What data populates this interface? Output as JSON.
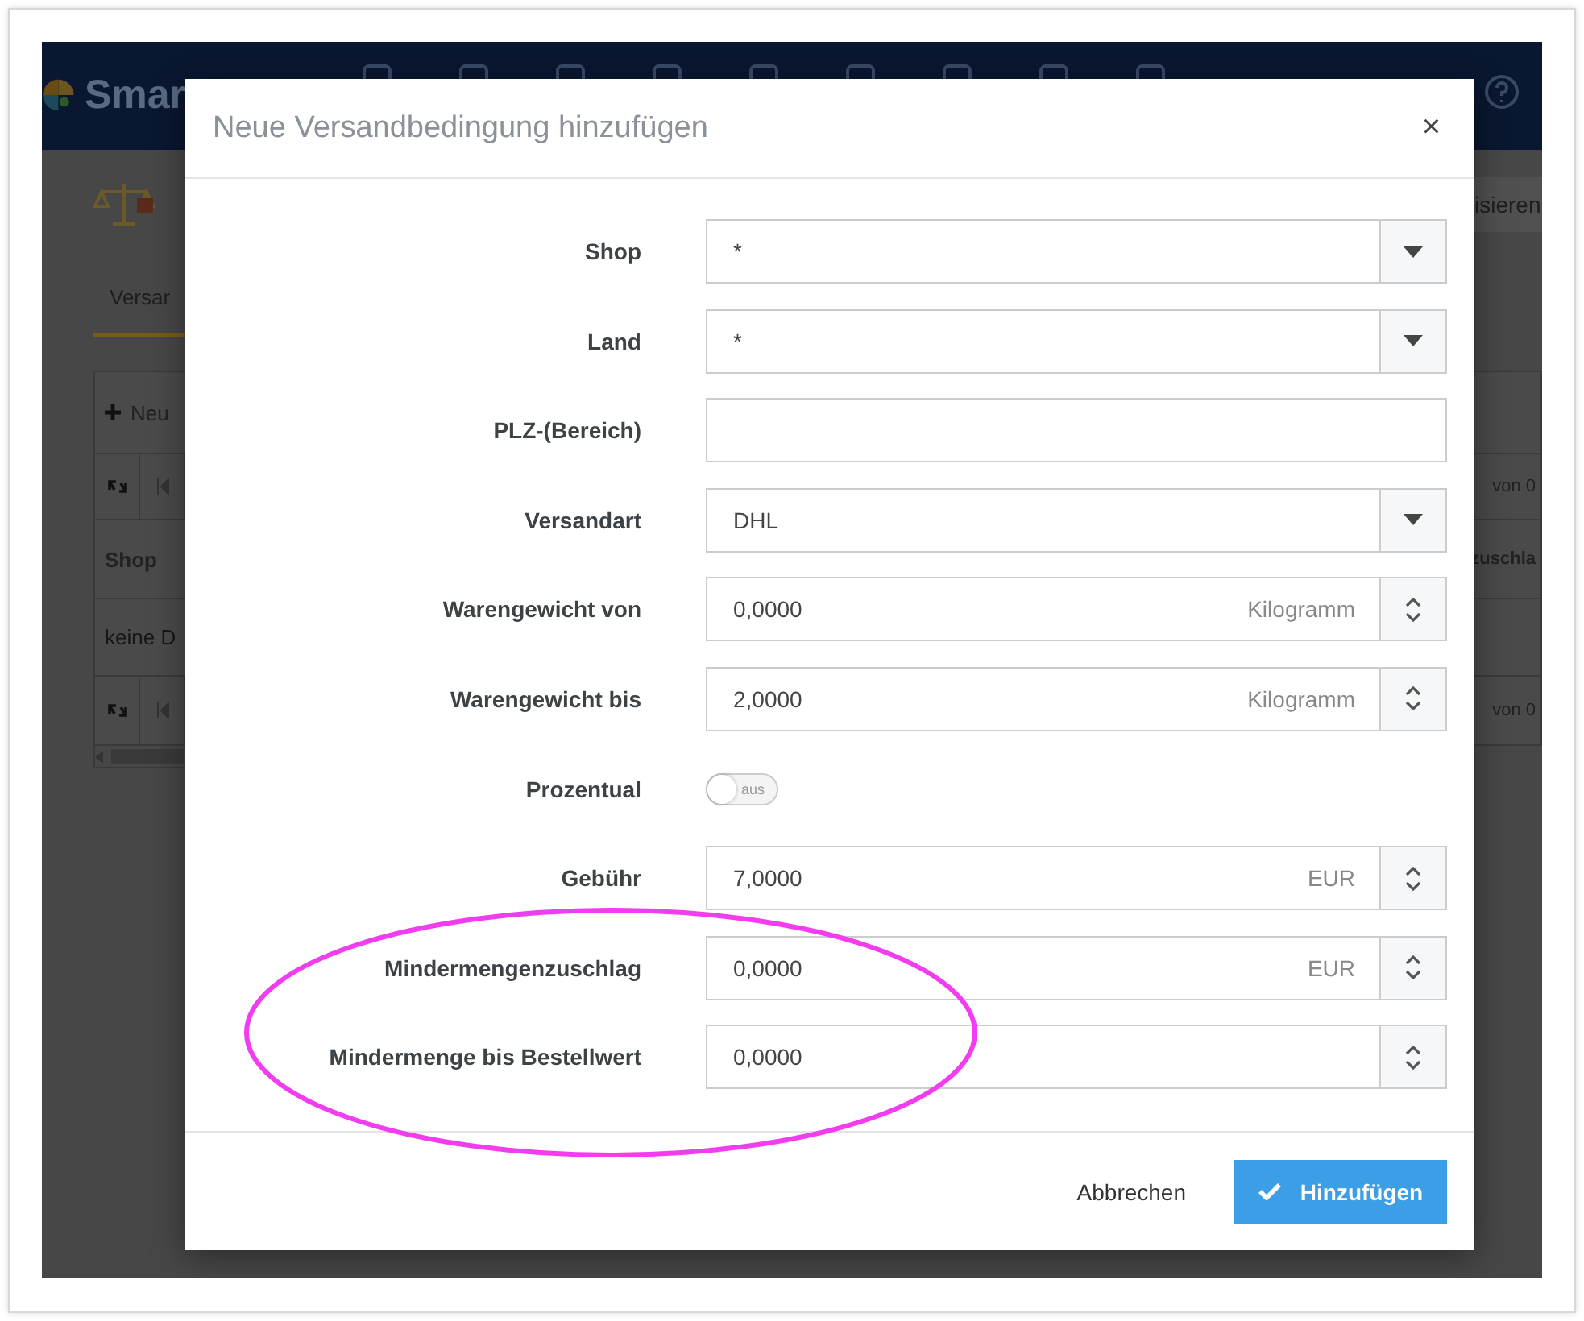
{
  "background": {
    "brand": "Smar",
    "header_button": "isieren",
    "tab": "Versar",
    "toolbar_button": "Neu",
    "pager_text": "von 0",
    "column_1": "Shop",
    "column_last": "zuschla",
    "empty_text": "keine D",
    "pager_text_bottom": "von 0"
  },
  "dialog": {
    "title": "Neue Versandbedingung hinzufügen",
    "close": "×",
    "fields": [
      {
        "kind": "select",
        "label": "Shop",
        "value": "*"
      },
      {
        "kind": "select",
        "label": "Land",
        "value": "*"
      },
      {
        "kind": "text",
        "label": "PLZ-(Bereich)"
      },
      {
        "kind": "select",
        "label": "Versandart",
        "value": "DHL"
      },
      {
        "kind": "number",
        "label": "Warengewicht von",
        "value": "0,0000",
        "unit": "Kilogramm"
      },
      {
        "kind": "number",
        "label": "Warengewicht bis",
        "value": "2,0000",
        "unit": "Kilogramm"
      },
      {
        "kind": "toggle",
        "label": "Prozentual",
        "on": false,
        "state_text": "aus"
      },
      {
        "kind": "number",
        "label": "Gebühr",
        "value": "7,0000",
        "unit": "EUR"
      },
      {
        "kind": "number",
        "label": "Mindermengenzuschlag",
        "value": "0,0000",
        "unit": "EUR"
      },
      {
        "kind": "number",
        "label": "Mindermenge bis Bestellwert",
        "value": "0,0000"
      }
    ],
    "buttons": [
      {
        "kind": "link",
        "label": "Abbrechen"
      },
      {
        "kind": "primary",
        "label": "Hinzufügen"
      }
    ]
  }
}
